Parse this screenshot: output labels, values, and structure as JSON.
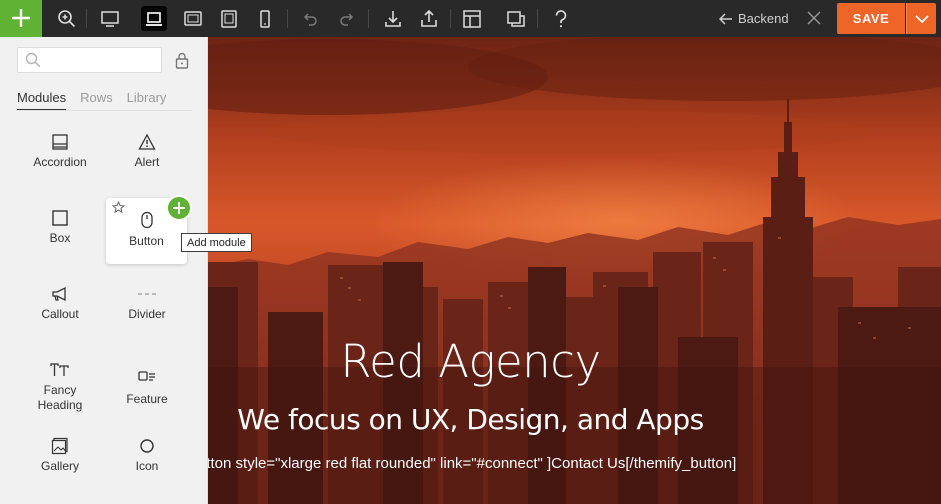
{
  "toolbar": {
    "add_icon": "plus-icon",
    "icons": [
      "zoom-icon",
      "desktop-icon",
      "laptop-icon",
      "tablet-landscape-icon",
      "tablet-portrait-icon",
      "mobile-icon",
      "undo-icon",
      "redo-icon",
      "import-icon",
      "export-icon",
      "layout-icon",
      "duplicate-icon",
      "help-icon"
    ],
    "backend_label": "Backend",
    "save_label": "SAVE",
    "accent": "#ef6527",
    "add_color": "#5fb233"
  },
  "panel": {
    "search": {
      "placeholder": "",
      "value": ""
    },
    "tabs": [
      {
        "label": "Modules",
        "active": true
      },
      {
        "label": "Rows",
        "active": false
      },
      {
        "label": "Library",
        "active": false
      }
    ],
    "modules": [
      {
        "label": "Accordion",
        "icon": "accordion-icon"
      },
      {
        "label": "Alert",
        "icon": "alert-icon"
      },
      {
        "label": "Box",
        "icon": "box-icon"
      },
      {
        "label": "Button",
        "icon": "mouse-icon"
      },
      {
        "label": "Callout",
        "icon": "megaphone-icon"
      },
      {
        "label": "Divider",
        "icon": "divider-icon"
      },
      {
        "label": "Fancy Heading",
        "icon": "text-height-icon"
      },
      {
        "label": "Feature",
        "icon": "feature-icon"
      },
      {
        "label": "Gallery",
        "icon": "gallery-icon"
      },
      {
        "label": "Icon",
        "icon": "circle-icon"
      }
    ],
    "tooltip": "Add module"
  },
  "hero": {
    "title": "Red Agency",
    "subtitle": "We focus on UX, Design, and Apps",
    "shortcode": "utton style=\"xlarge red flat rounded\" link=\"#connect\" ]Contact Us[/themify_button]"
  }
}
